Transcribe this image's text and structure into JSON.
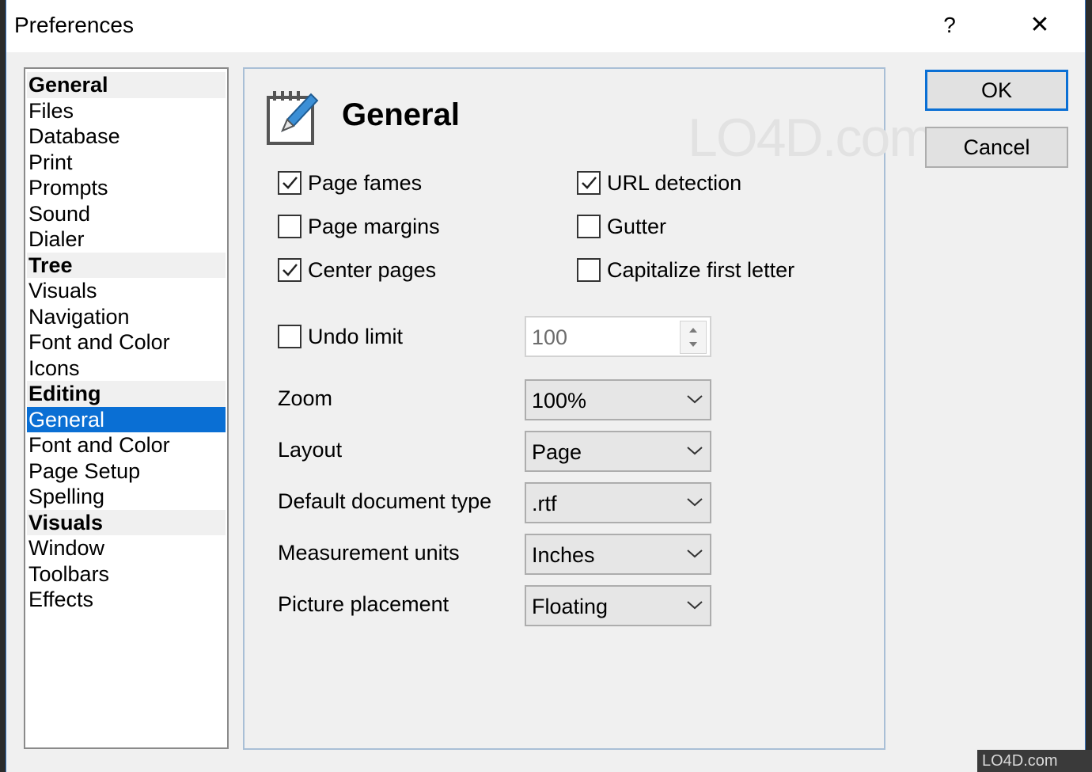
{
  "window": {
    "title": "Preferences",
    "help_label": "?",
    "close_label": "✕"
  },
  "categories": [
    {
      "label": "General",
      "type": "header"
    },
    {
      "label": "Files",
      "type": "item"
    },
    {
      "label": "Database",
      "type": "item"
    },
    {
      "label": "Print",
      "type": "item"
    },
    {
      "label": "Prompts",
      "type": "item"
    },
    {
      "label": "Sound",
      "type": "item"
    },
    {
      "label": "Dialer",
      "type": "item"
    },
    {
      "label": "Tree",
      "type": "header"
    },
    {
      "label": "Visuals",
      "type": "item"
    },
    {
      "label": "Navigation",
      "type": "item"
    },
    {
      "label": "Font and Color",
      "type": "item"
    },
    {
      "label": "Icons",
      "type": "item"
    },
    {
      "label": "Editing",
      "type": "header"
    },
    {
      "label": "General",
      "type": "item",
      "selected": true
    },
    {
      "label": "Font and Color",
      "type": "item"
    },
    {
      "label": "Page Setup",
      "type": "item"
    },
    {
      "label": "Spelling",
      "type": "item"
    },
    {
      "label": "Visuals",
      "type": "header"
    },
    {
      "label": "Window",
      "type": "item"
    },
    {
      "label": "Toolbars",
      "type": "item"
    },
    {
      "label": "Effects",
      "type": "item"
    }
  ],
  "panel": {
    "title": "General",
    "icon": "notepad-pencil-icon",
    "watermark": "LO4D.com",
    "checkboxes": {
      "page_fames": {
        "label": "Page fames",
        "checked": true
      },
      "url_detection": {
        "label": "URL detection",
        "checked": true
      },
      "page_margins": {
        "label": "Page margins",
        "checked": false
      },
      "gutter": {
        "label": "Gutter",
        "checked": false
      },
      "center_pages": {
        "label": "Center pages",
        "checked": true
      },
      "capitalize": {
        "label": "Capitalize first letter",
        "checked": false
      },
      "undo_limit": {
        "label": "Undo limit",
        "checked": false
      }
    },
    "undo_limit_value": "100",
    "fields": {
      "zoom": {
        "label": "Zoom",
        "value": "100%"
      },
      "layout": {
        "label": "Layout",
        "value": "Page"
      },
      "doc_type": {
        "label": "Default document type",
        "value": ".rtf"
      },
      "units": {
        "label": "Measurement units",
        "value": "Inches"
      },
      "picture": {
        "label": "Picture placement",
        "value": "Floating"
      }
    }
  },
  "buttons": {
    "ok": "OK",
    "cancel": "Cancel"
  },
  "corner_logo": "LO4D.com",
  "colors": {
    "selection": "#0a6fd4",
    "default_button_border": "#0a6fd4"
  }
}
